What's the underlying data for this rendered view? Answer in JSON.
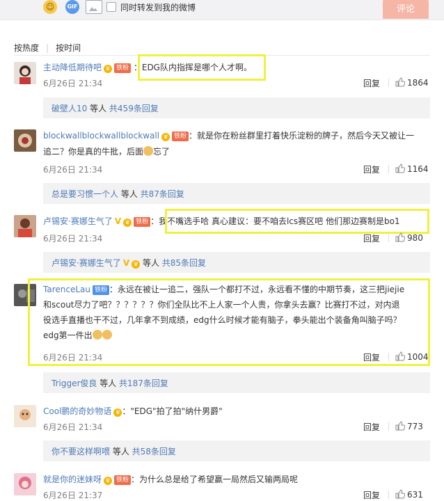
{
  "top": {
    "checkbox_label": "同时转发到我的微博",
    "comment_button": "评论",
    "gif_label": "GIF"
  },
  "sort": {
    "hot": "按热度",
    "time": "按时间"
  },
  "comments": [
    {
      "user": "主动降低期待吧",
      "badge": "铁粉",
      "text": "EDG队内指挥是哪个人才啊。",
      "date": "6月26日 21:34",
      "reply": "回复",
      "likes": "1864",
      "sub_user": "破壁人10",
      "sub_mid": " 等人 ",
      "sub_count": "共459条回复"
    },
    {
      "user": "blockwallblockwallblockwall",
      "badge": "铁粉",
      "text1": "：就是你在粉丝群里打着快乐淀粉的牌子，然后今天又被让一",
      "text2": "追二？你是真的牛批，后面",
      "text2b": "忘了",
      "date": "6月26日 21:34",
      "reply": "回复",
      "likes": "1164",
      "sub_user": "总是要习惯一个人",
      "sub_mid": " 等人 ",
      "sub_count": "共87条回复"
    },
    {
      "user": "卢锡安·赛娜生气了",
      "badge": "铁粉",
      "text": "我不嘴选手哈 真心建议：要不咱去lcs赛区吧 他们那边赛制是bo1",
      "date": "6月26日 21:34",
      "reply": "回复",
      "likes": "980",
      "sub_user": "卢锡安·赛娜生气了",
      "sub_mid": " 等人 ",
      "sub_count": "共85条回复"
    },
    {
      "user": "TarenceLau",
      "badge": "铁粉",
      "line1": "：永远在被让一追二，强队一个都打不过，永远看不懂的中期节奏，这三把jiejie",
      "line2": "和scout尽力了吧？？？？？？你们全队比不上人家一个人贵，你拿头去赢？比赛打不过，对内退",
      "line3": "役选手直播也干不过，几年拿不到成绩，edg什么时候才能有脑子，拳头能出个装备角叫脑子吗？",
      "line4": "edg第一件出",
      "date": "6月26日 21:34",
      "reply": "回复",
      "likes": "1004",
      "sub_user": "Trigger俊良",
      "sub_mid": " 等人 ",
      "sub_count": "共187条回复"
    },
    {
      "user": "Cool鹏的奇妙物语",
      "text": "：\"EDG\"拍了拍\"纳什男爵\"",
      "date": "6月26日 21:34",
      "reply": "回复",
      "likes": "773",
      "sub_user": "你不要这样啊喂",
      "sub_mid": " 等人 ",
      "sub_count": "共58条回复"
    },
    {
      "user": "就是你的迷妹呀",
      "badge": "铁粉",
      "text": "：为什么总是给了希望赢一局然后又输两局呢",
      "date": "6月26日 21:37",
      "reply": "回复",
      "likes": "631"
    }
  ],
  "colors": {
    "link": "#4e7ab7",
    "highlight": "#f0f040",
    "badge": "#f06b4a",
    "button": "#f6b6a6"
  }
}
